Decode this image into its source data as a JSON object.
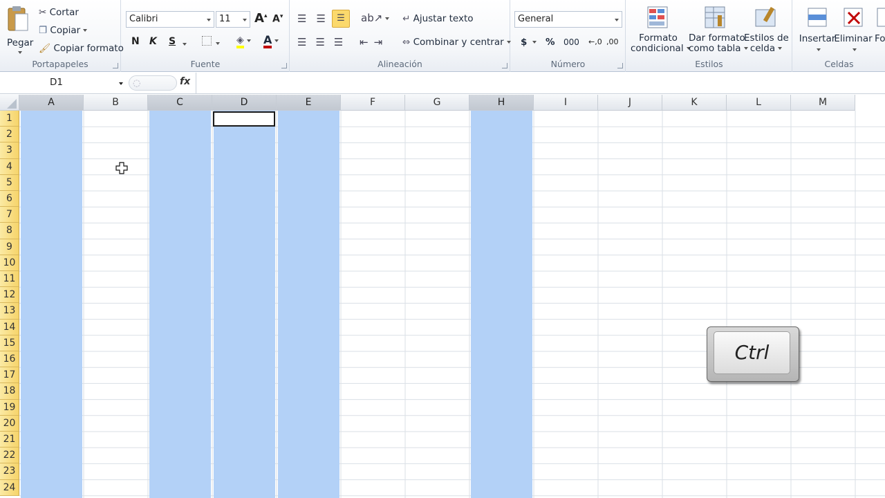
{
  "clipboard": {
    "paste": "Pegar",
    "cut": "Cortar",
    "copy": "Copiar",
    "format_painter": "Copiar formato",
    "group": "Portapapeles"
  },
  "font": {
    "name": "Calibri",
    "size": "11",
    "bold": "N",
    "italic": "K",
    "underline": "S",
    "group": "Fuente",
    "grow": "A",
    "shrink": "A",
    "color_letter": "A"
  },
  "alignment": {
    "wrap": "Ajustar texto",
    "merge": "Combinar y centrar",
    "group": "Alineación"
  },
  "number": {
    "format": "General",
    "currency": "$",
    "percent": "%",
    "thousands": "000",
    "inc_decimal": "←,0",
    "dec_decimal": ",00",
    "group": "Número"
  },
  "styles": {
    "cond_format_1": "Formato",
    "cond_format_2": "condicional",
    "table_format_1": "Dar formato",
    "table_format_2": "como tabla",
    "cell_styles_1": "Estilos de",
    "cell_styles_2": "celda",
    "group": "Estilos"
  },
  "cells": {
    "insert": "Insertar",
    "delete": "Eliminar",
    "format": "For",
    "group": "Celdas"
  },
  "formula_bar": {
    "name_box": "D1",
    "fx": "fx",
    "content": ""
  },
  "columns": [
    "A",
    "B",
    "C",
    "D",
    "E",
    "F",
    "G",
    "H",
    "I",
    "J",
    "K",
    "L",
    "M"
  ],
  "selected_columns": [
    "A",
    "C",
    "D",
    "E",
    "H"
  ],
  "rows": [
    "1",
    "2",
    "3",
    "4",
    "5",
    "6",
    "7",
    "8",
    "9",
    "10",
    "11",
    "12",
    "13",
    "14",
    "15",
    "16",
    "17",
    "18",
    "19",
    "20",
    "21",
    "22",
    "23",
    "24"
  ],
  "active_cell": "D1",
  "key_overlay": "Ctrl",
  "colors": {
    "selection": "#b3d1f7",
    "row_header": "#f8dc80",
    "accent_red": "#c00000"
  }
}
